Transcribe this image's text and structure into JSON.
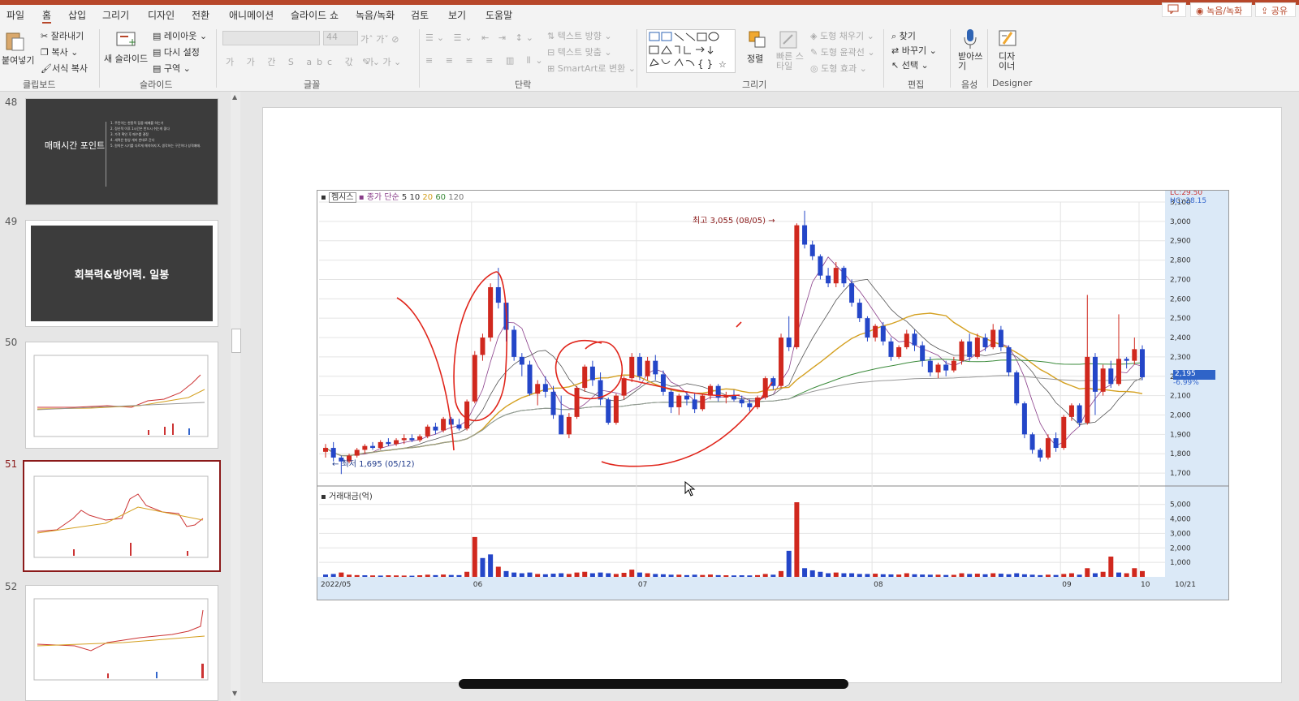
{
  "menu": {
    "tabs": [
      "파일",
      "홈",
      "삽입",
      "그리기",
      "디자인",
      "전환",
      "애니메이션",
      "슬라이드 쇼",
      "녹음/녹화",
      "검토",
      "보기",
      "도움말"
    ],
    "active_tab": "홈",
    "record_button": "녹음/녹화",
    "share_button": "공유"
  },
  "ribbon": {
    "clipboard": {
      "paste": "붙여넣기",
      "cut": "잘라내기",
      "copy": "복사",
      "format_painter": "서식 복사",
      "group": "클립보드"
    },
    "slides": {
      "new_slide": "새 슬라이드",
      "layout": "레이아웃",
      "reset": "다시 설정",
      "section": "구역",
      "group": "슬라이드"
    },
    "font": {
      "group": "글꼴",
      "size": "44"
    },
    "paragraph": {
      "text_direction": "텍스트 방향",
      "align_text": "텍스트 맞춤",
      "smartart": "SmartArt로 변환",
      "group": "단락"
    },
    "drawing": {
      "arrange": "정렬",
      "quick_styles": "빠른 스타일",
      "shape_fill": "도형 채우기",
      "shape_outline": "도형 윤곽선",
      "shape_effects": "도형 효과",
      "group": "그리기"
    },
    "editing": {
      "find": "찾기",
      "replace": "바꾸기",
      "select": "선택",
      "group": "편집"
    },
    "voice": {
      "dictate": "받아쓰기",
      "group": "음성"
    },
    "designer": {
      "label": "디자이너",
      "group": "Designer"
    }
  },
  "slides_panel": {
    "slides": [
      {
        "number": "48",
        "title": "매매시간 포인트",
        "bullets": [
          "1. 주린이는 한종목 집중 매매를 하는거",
          "2. 정신적 이후 1시간은 반드시 쉬는게 좋다",
          "3. 가격 확인 후 매수를 결정",
          "4. 세력은 항상 개미 반대로 간다",
          "5. 원칙은 시기를 다르게 해석하지 X, 생각하는 구간이다 성격매매."
        ]
      },
      {
        "number": "49",
        "title": "회복력&방어력. 일봉"
      },
      {
        "number": "50"
      },
      {
        "number": "51"
      },
      {
        "number": "52"
      }
    ],
    "selected": "51"
  },
  "chart_legend": {
    "name": "켐시스",
    "ma_label": "종가 단순",
    "ma_periods": [
      "5",
      "10",
      "20",
      "60",
      "120"
    ]
  },
  "chart_data": {
    "type": "candlestick",
    "price_axis": {
      "ticks": [
        3100,
        3000,
        2900,
        2800,
        2700,
        2600,
        2500,
        2400,
        2300,
        2200,
        2100,
        2000,
        1900,
        1800,
        1700
      ],
      "ylim": [
        1650,
        3100
      ]
    },
    "volume_axis": {
      "title": "거래대금(억)",
      "ticks": [
        5000,
        4000,
        3000,
        2000,
        1000
      ],
      "ylim": [
        0,
        5600
      ]
    },
    "x_labels": [
      "2022/05",
      "06",
      "07",
      "08",
      "09",
      "10",
      "10/21"
    ],
    "high_annotation": "최고 3,055 (08/05)",
    "low_annotation": "최저 1,695 (05/12)",
    "top_right_lc": "LC:29.50",
    "top_right_hc": "HC:-28.15",
    "current_price": "2,195",
    "current_change": "-6.99%",
    "candles": [
      [
        1810,
        1850,
        1780,
        1830
      ],
      [
        1830,
        1860,
        1760,
        1780
      ],
      [
        1780,
        1790,
        1695,
        1760
      ],
      [
        1760,
        1800,
        1750,
        1790
      ],
      [
        1790,
        1830,
        1780,
        1820
      ],
      [
        1820,
        1850,
        1800,
        1840
      ],
      [
        1840,
        1860,
        1820,
        1830
      ],
      [
        1830,
        1870,
        1820,
        1860
      ],
      [
        1860,
        1880,
        1840,
        1850
      ],
      [
        1850,
        1880,
        1840,
        1870
      ],
      [
        1870,
        1900,
        1850,
        1880
      ],
      [
        1880,
        1900,
        1860,
        1870
      ],
      [
        1870,
        1900,
        1860,
        1890
      ],
      [
        1890,
        1950,
        1880,
        1940
      ],
      [
        1940,
        1960,
        1900,
        1920
      ],
      [
        1920,
        1990,
        1910,
        1980
      ],
      [
        1980,
        1990,
        1930,
        1950
      ],
      [
        1950,
        1980,
        1920,
        1930
      ],
      [
        1930,
        2080,
        1920,
        2070
      ],
      [
        2070,
        2330,
        2060,
        2310
      ],
      [
        2310,
        2420,
        2280,
        2400
      ],
      [
        2400,
        2680,
        2380,
        2660
      ],
      [
        2660,
        2760,
        2550,
        2580
      ],
      [
        2580,
        2560,
        2380,
        2440
      ],
      [
        2440,
        2460,
        2280,
        2300
      ],
      [
        2300,
        2320,
        2200,
        2260
      ],
      [
        2260,
        2280,
        2100,
        2110
      ],
      [
        2110,
        2180,
        2050,
        2160
      ],
      [
        2160,
        2200,
        2090,
        2120
      ],
      [
        2120,
        2150,
        1980,
        2000
      ],
      [
        2000,
        2100,
        1920,
        1900
      ],
      [
        1900,
        2010,
        1880,
        1990
      ],
      [
        1990,
        2150,
        1980,
        2140
      ],
      [
        2140,
        2260,
        2120,
        2250
      ],
      [
        2250,
        2280,
        2150,
        2180
      ],
      [
        2180,
        2220,
        2050,
        2080
      ],
      [
        2080,
        2090,
        1950,
        1960
      ],
      [
        1960,
        2110,
        1950,
        2100
      ],
      [
        2100,
        2200,
        2080,
        2190
      ],
      [
        2190,
        2320,
        2170,
        2300
      ],
      [
        2300,
        2320,
        2180,
        2200
      ],
      [
        2200,
        2300,
        2180,
        2280
      ],
      [
        2280,
        2310,
        2180,
        2210
      ],
      [
        2210,
        2230,
        2100,
        2120
      ],
      [
        2120,
        2130,
        2010,
        2040
      ],
      [
        2040,
        2110,
        2000,
        2100
      ],
      [
        2100,
        2120,
        2050,
        2080
      ],
      [
        2080,
        2110,
        2010,
        2030
      ],
      [
        2030,
        2110,
        2020,
        2100
      ],
      [
        2100,
        2160,
        2080,
        2150
      ],
      [
        2150,
        2160,
        2070,
        2090
      ],
      [
        2090,
        2120,
        2060,
        2100
      ],
      [
        2100,
        2130,
        2070,
        2080
      ],
      [
        2080,
        2100,
        2040,
        2060
      ],
      [
        2060,
        2080,
        2020,
        2040
      ],
      [
        2040,
        2100,
        2030,
        2090
      ],
      [
        2090,
        2200,
        2080,
        2190
      ],
      [
        2190,
        2200,
        2130,
        2150
      ],
      [
        2150,
        2420,
        2140,
        2400
      ],
      [
        2400,
        2510,
        2330,
        2350
      ],
      [
        2350,
        2990,
        2340,
        2980
      ],
      [
        2980,
        3055,
        2860,
        2880
      ],
      [
        2880,
        2900,
        2800,
        2820
      ],
      [
        2820,
        2830,
        2700,
        2720
      ],
      [
        2720,
        2760,
        2660,
        2680
      ],
      [
        2680,
        2790,
        2660,
        2760
      ],
      [
        2760,
        2770,
        2660,
        2680
      ],
      [
        2680,
        2700,
        2560,
        2580
      ],
      [
        2580,
        2600,
        2480,
        2500
      ],
      [
        2500,
        2510,
        2380,
        2400
      ],
      [
        2400,
        2470,
        2380,
        2460
      ],
      [
        2460,
        2480,
        2360,
        2380
      ],
      [
        2380,
        2400,
        2280,
        2300
      ],
      [
        2300,
        2360,
        2290,
        2350
      ],
      [
        2350,
        2440,
        2340,
        2420
      ],
      [
        2420,
        2440,
        2330,
        2360
      ],
      [
        2360,
        2380,
        2250,
        2280
      ],
      [
        2280,
        2300,
        2200,
        2220
      ],
      [
        2220,
        2270,
        2190,
        2260
      ],
      [
        2260,
        2280,
        2200,
        2230
      ],
      [
        2230,
        2300,
        2220,
        2280
      ],
      [
        2280,
        2390,
        2260,
        2380
      ],
      [
        2380,
        2420,
        2280,
        2300
      ],
      [
        2300,
        2420,
        2290,
        2400
      ],
      [
        2400,
        2420,
        2330,
        2350
      ],
      [
        2350,
        2470,
        2340,
        2440
      ],
      [
        2440,
        2460,
        2330,
        2350
      ],
      [
        2350,
        2360,
        2200,
        2220
      ],
      [
        2220,
        2230,
        2050,
        2060
      ],
      [
        2060,
        2070,
        1880,
        1900
      ],
      [
        1900,
        1910,
        1800,
        1820
      ],
      [
        1820,
        1830,
        1760,
        1780
      ],
      [
        1780,
        1900,
        1770,
        1880
      ],
      [
        1880,
        1910,
        1810,
        1830
      ],
      [
        1830,
        2000,
        1820,
        1990
      ],
      [
        1990,
        2060,
        1970,
        2050
      ],
      [
        2050,
        2060,
        1940,
        1960
      ],
      [
        1960,
        2620,
        1950,
        2300
      ],
      [
        2300,
        2320,
        2000,
        2120
      ],
      [
        2120,
        2260,
        2100,
        2240
      ],
      [
        2240,
        2280,
        2140,
        2160
      ],
      [
        2160,
        2520,
        2150,
        2290
      ],
      [
        2290,
        2300,
        2240,
        2280
      ],
      [
        2280,
        2400,
        2260,
        2340
      ],
      [
        2340,
        2360,
        2180,
        2195
      ]
    ],
    "volume": [
      [
        160,
        0
      ],
      [
        200,
        0
      ],
      [
        300,
        1
      ],
      [
        150,
        1
      ],
      [
        120,
        1
      ],
      [
        110,
        0
      ],
      [
        100,
        1
      ],
      [
        90,
        0
      ],
      [
        110,
        1
      ],
      [
        100,
        1
      ],
      [
        90,
        1
      ],
      [
        80,
        0
      ],
      [
        110,
        1
      ],
      [
        150,
        1
      ],
      [
        120,
        0
      ],
      [
        160,
        1
      ],
      [
        130,
        0
      ],
      [
        120,
        0
      ],
      [
        350,
        1
      ],
      [
        2750,
        1
      ],
      [
        1300,
        0
      ],
      [
        1550,
        0
      ],
      [
        700,
        1
      ],
      [
        400,
        0
      ],
      [
        300,
        0
      ],
      [
        250,
        0
      ],
      [
        300,
        0
      ],
      [
        200,
        1
      ],
      [
        180,
        0
      ],
      [
        220,
        0
      ],
      [
        250,
        0
      ],
      [
        200,
        1
      ],
      [
        300,
        1
      ],
      [
        350,
        1
      ],
      [
        250,
        0
      ],
      [
        300,
        0
      ],
      [
        250,
        0
      ],
      [
        200,
        1
      ],
      [
        280,
        1
      ],
      [
        500,
        1
      ],
      [
        300,
        0
      ],
      [
        250,
        1
      ],
      [
        200,
        0
      ],
      [
        180,
        0
      ],
      [
        150,
        0
      ],
      [
        150,
        1
      ],
      [
        120,
        0
      ],
      [
        150,
        0
      ],
      [
        130,
        1
      ],
      [
        160,
        1
      ],
      [
        120,
        0
      ],
      [
        110,
        1
      ],
      [
        100,
        0
      ],
      [
        110,
        0
      ],
      [
        100,
        0
      ],
      [
        120,
        1
      ],
      [
        200,
        1
      ],
      [
        150,
        0
      ],
      [
        400,
        1
      ],
      [
        1800,
        0
      ],
      [
        5150,
        1
      ],
      [
        600,
        0
      ],
      [
        450,
        0
      ],
      [
        350,
        0
      ],
      [
        250,
        0
      ],
      [
        300,
        1
      ],
      [
        250,
        0
      ],
      [
        250,
        0
      ],
      [
        200,
        0
      ],
      [
        200,
        0
      ],
      [
        220,
        1
      ],
      [
        180,
        0
      ],
      [
        170,
        0
      ],
      [
        160,
        1
      ],
      [
        250,
        1
      ],
      [
        180,
        0
      ],
      [
        160,
        0
      ],
      [
        150,
        0
      ],
      [
        150,
        1
      ],
      [
        130,
        0
      ],
      [
        140,
        1
      ],
      [
        250,
        1
      ],
      [
        200,
        0
      ],
      [
        220,
        1
      ],
      [
        180,
        0
      ],
      [
        250,
        1
      ],
      [
        220,
        0
      ],
      [
        180,
        0
      ],
      [
        250,
        0
      ],
      [
        180,
        0
      ],
      [
        150,
        0
      ],
      [
        120,
        0
      ],
      [
        150,
        1
      ],
      [
        130,
        0
      ],
      [
        200,
        1
      ],
      [
        250,
        1
      ],
      [
        150,
        0
      ],
      [
        600,
        1
      ],
      [
        250,
        0
      ],
      [
        350,
        1
      ],
      [
        1400,
        1
      ],
      [
        300,
        0
      ],
      [
        250,
        1
      ],
      [
        600,
        1
      ],
      [
        400,
        1
      ]
    ]
  }
}
